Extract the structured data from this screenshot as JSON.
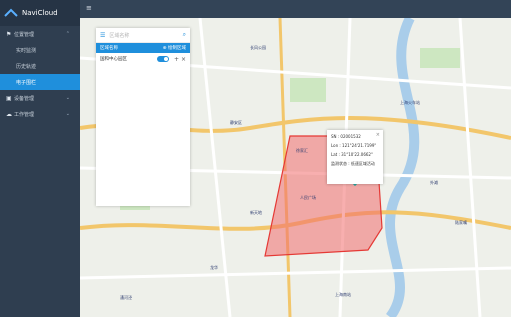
{
  "app": {
    "brand": "NaviCloud"
  },
  "sidebar": {
    "items": [
      {
        "label": "位置管理",
        "type": "parent",
        "icon": "pin-icon"
      },
      {
        "label": "实时监测",
        "type": "child"
      },
      {
        "label": "历史轨迹",
        "type": "child"
      },
      {
        "label": "电子围栏",
        "type": "child",
        "active": true
      },
      {
        "label": "设备管理",
        "type": "parent",
        "icon": "device-icon"
      },
      {
        "label": "工作管理",
        "type": "parent",
        "icon": "cloud-icon"
      }
    ]
  },
  "panel": {
    "search_placeholder": "区域名称",
    "title": "区域名称",
    "draw_button": "绘制区域",
    "rows": [
      {
        "label": "国和中心园区"
      }
    ]
  },
  "popup": {
    "sn": "SN : 02001532",
    "lon": "Lon : 121°24'21.7199\"",
    "lat": "Lat : 31°10'22.0662\"",
    "speed": "监测状态 : 低速区域活动"
  },
  "map": {
    "labels": [
      "普陀区",
      "徐家汇",
      "静安区",
      "长风公园",
      "上海火车站",
      "人民广场",
      "新天地",
      "龙华",
      "上海南站",
      "漕河泾",
      "外滩",
      "陆家嘴"
    ],
    "fence_color": "#f26e6e",
    "fence_stroke": "#e53935"
  }
}
